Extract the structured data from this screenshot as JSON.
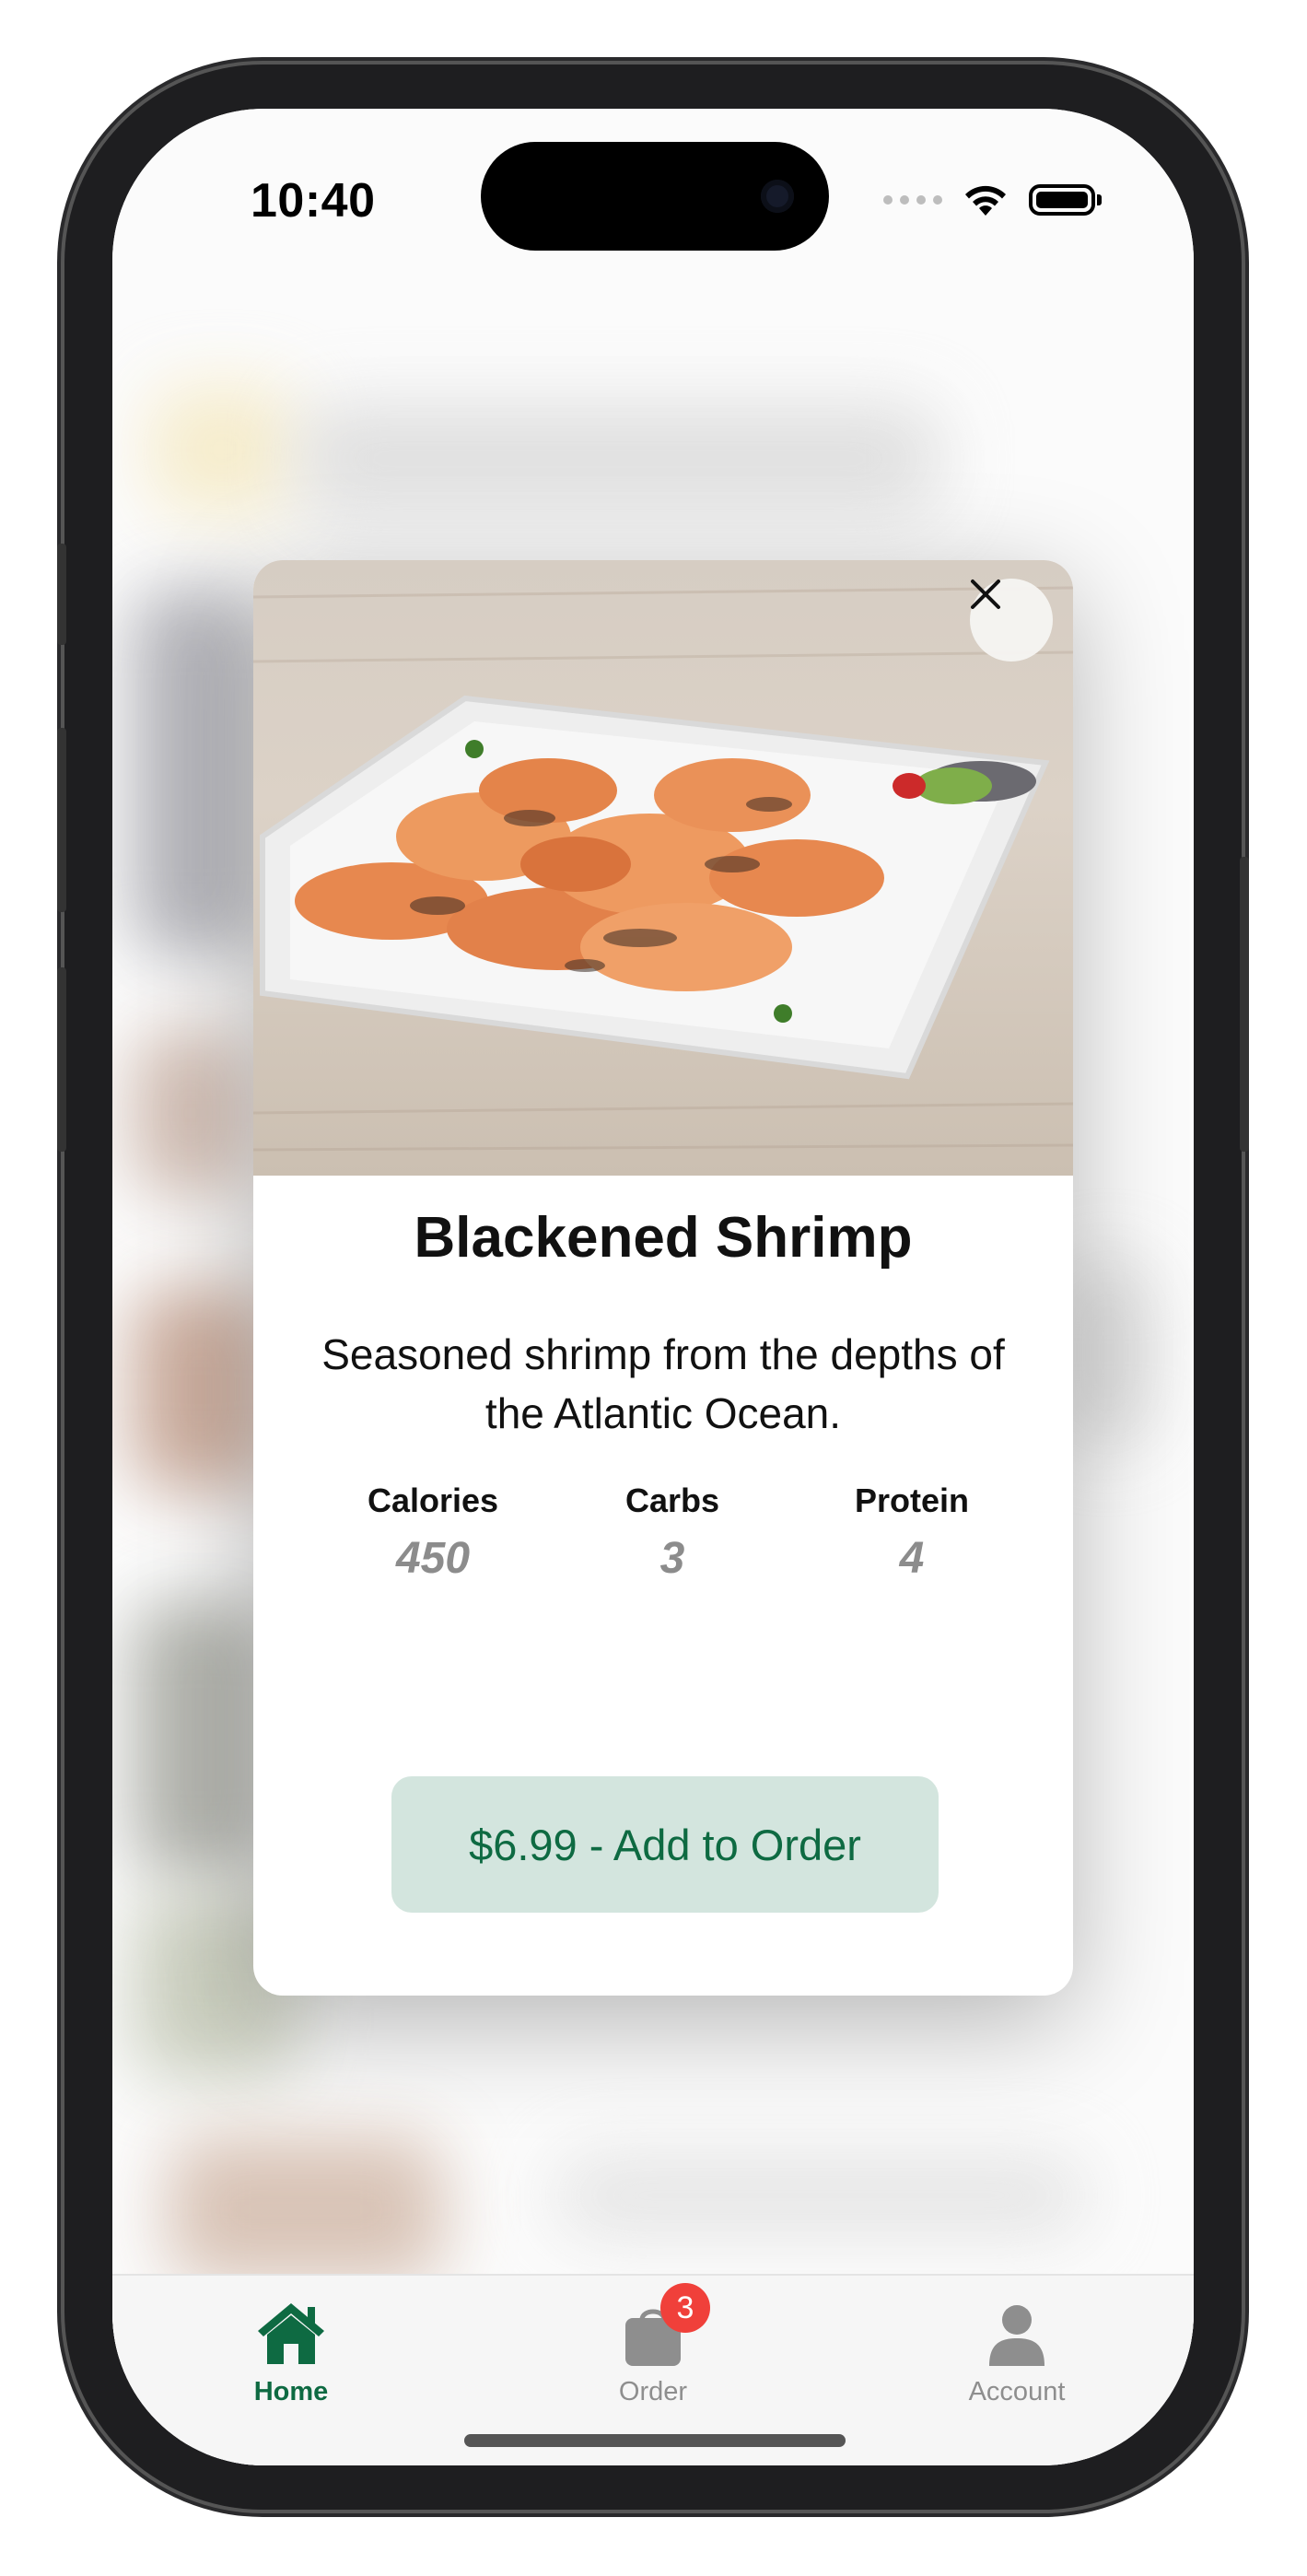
{
  "status_bar": {
    "time": "10:40"
  },
  "modal": {
    "close_icon": "close-icon",
    "image_subject": "shrimp-photo",
    "title": "Blackened Shrimp",
    "description": "Seasoned shrimp from the depths of the Atlantic Ocean.",
    "nutrition": [
      {
        "label": "Calories",
        "value": "450"
      },
      {
        "label": "Carbs",
        "value": "3"
      },
      {
        "label": "Protein",
        "value": "4"
      }
    ],
    "add_button_label": "$6.99 - Add to Order"
  },
  "tab_bar": {
    "tabs": [
      {
        "label": "Home",
        "icon": "house-icon",
        "active": true
      },
      {
        "label": "Order",
        "icon": "bag-icon",
        "badge": "3",
        "active": false
      },
      {
        "label": "Account",
        "icon": "person-icon",
        "active": false
      }
    ]
  },
  "colors": {
    "accent": "#0e6a42",
    "button_bg": "#d3e5de",
    "badge": "#f0403a",
    "muted_value": "#8c8c8c"
  }
}
